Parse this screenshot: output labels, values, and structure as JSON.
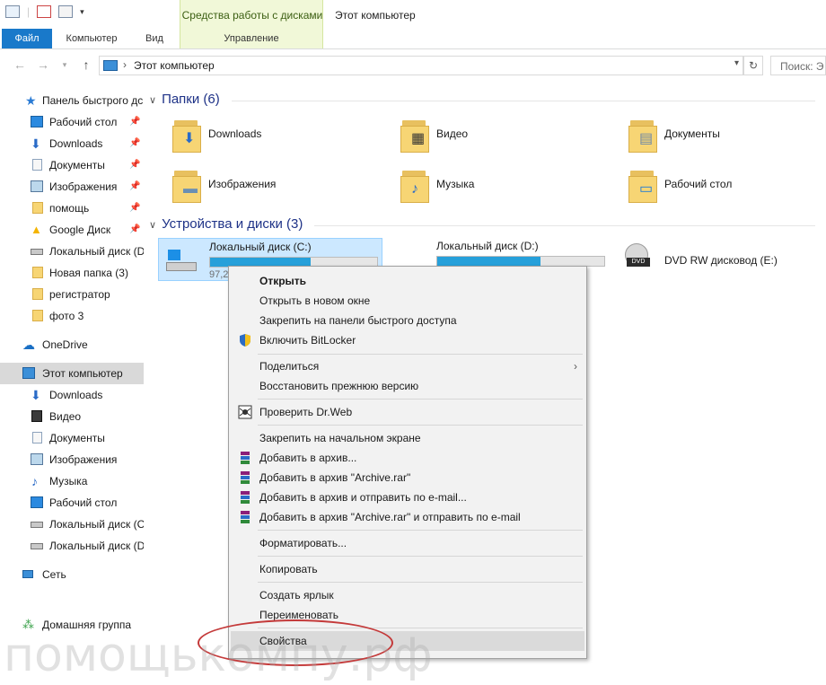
{
  "window": {
    "title": "Этот компьютер",
    "context_tab_group": "Средства работы с дисками"
  },
  "ribbon": {
    "tabs": [
      {
        "label": "Файл",
        "active": true
      },
      {
        "label": "Компьютер"
      },
      {
        "label": "Вид"
      },
      {
        "label": "Управление"
      }
    ]
  },
  "address": {
    "path": "Этот компьютер",
    "search_placeholder": "Поиск: Э"
  },
  "sidebar": {
    "items": [
      {
        "label": "Панель быстрого дс",
        "icon": "star-icon",
        "pinned": false
      },
      {
        "label": "Рабочий стол",
        "icon": "desktop-icon",
        "pinned": true
      },
      {
        "label": "Downloads",
        "icon": "download-arrow-icon",
        "pinned": true
      },
      {
        "label": "Документы",
        "icon": "document-icon",
        "pinned": true
      },
      {
        "label": "Изображения",
        "icon": "pictures-icon",
        "pinned": true
      },
      {
        "label": "помощь",
        "icon": "folder-icon",
        "pinned": true
      },
      {
        "label": "Google Диск",
        "icon": "google-drive-icon",
        "pinned": true
      },
      {
        "label": "Локальный диск (D",
        "icon": "drive-icon",
        "pinned": false
      },
      {
        "label": "Новая папка (3)",
        "icon": "folder-icon",
        "pinned": false
      },
      {
        "label": "регистратор",
        "icon": "folder-icon",
        "pinned": false
      },
      {
        "label": "фото 3",
        "icon": "folder-icon",
        "pinned": false
      },
      {
        "label": "OneDrive",
        "icon": "cloud-icon",
        "pinned": false
      },
      {
        "label": "Этот компьютер",
        "icon": "computer-icon",
        "pinned": false,
        "selected": true
      },
      {
        "label": "Downloads",
        "icon": "download-arrow-icon",
        "pinned": false
      },
      {
        "label": "Видео",
        "icon": "video-icon",
        "pinned": false
      },
      {
        "label": "Документы",
        "icon": "document-icon",
        "pinned": false
      },
      {
        "label": "Изображения",
        "icon": "pictures-icon",
        "pinned": false
      },
      {
        "label": "Музыка",
        "icon": "music-icon",
        "pinned": false
      },
      {
        "label": "Рабочий стол",
        "icon": "desktop-icon",
        "pinned": false
      },
      {
        "label": "Локальный диск (C",
        "icon": "windows-drive-icon",
        "pinned": false
      },
      {
        "label": "Локальный диск (D",
        "icon": "drive-icon",
        "pinned": false
      },
      {
        "label": "Сеть",
        "icon": "network-icon",
        "pinned": false
      },
      {
        "label": "Домашняя группа",
        "icon": "homegroup-icon",
        "pinned": false
      }
    ]
  },
  "main": {
    "folders_header": "Папки (6)",
    "folders": [
      {
        "label": "Downloads",
        "icon": "download-arrow-icon"
      },
      {
        "label": "Видео",
        "icon": "video-icon"
      },
      {
        "label": "Документы",
        "icon": "document-icon"
      },
      {
        "label": "Изображения",
        "icon": "pictures-icon"
      },
      {
        "label": "Музыка",
        "icon": "music-icon"
      },
      {
        "label": "Рабочий стол",
        "icon": "desktop-icon"
      }
    ],
    "devices_header": "Устройства и диски (3)",
    "drives": [
      {
        "label": "Локальный диск (C:)",
        "size_text": "97,2",
        "used_fraction": 0.6,
        "icon": "windows-drive-icon",
        "selected": true
      },
      {
        "label": "Локальный диск (D:)",
        "used_fraction": 0.62,
        "icon": "drive-icon"
      },
      {
        "label": "DVD RW дисковод (E:)",
        "icon": "dvd-drive-icon"
      }
    ]
  },
  "context_menu": {
    "items": [
      {
        "label": "Открыть",
        "bold": true
      },
      {
        "label": "Открыть в новом окне"
      },
      {
        "label": "Закрепить на панели быстрого доступа"
      },
      {
        "label": "Включить BitLocker",
        "icon": "shield-icon"
      },
      {
        "label": "Поделиться",
        "submenu": true
      },
      {
        "label": "Восстановить прежнюю версию"
      },
      {
        "label": "Проверить Dr.Web",
        "icon": "drweb-spider-icon"
      },
      {
        "label": "Закрепить на начальном экране"
      },
      {
        "label": "Добавить в архив...",
        "icon": "winrar-icon"
      },
      {
        "label": "Добавить в архив \"Archive.rar\"",
        "icon": "winrar-icon"
      },
      {
        "label": "Добавить в архив и отправить по e-mail...",
        "icon": "winrar-icon"
      },
      {
        "label": "Добавить в архив \"Archive.rar\" и отправить по e-mail",
        "icon": "winrar-icon"
      },
      {
        "label": "Форматировать..."
      },
      {
        "label": "Копировать"
      },
      {
        "label": "Создать ярлык"
      },
      {
        "label": "Переименовать"
      },
      {
        "label": "Свойства",
        "highlighted": true
      }
    ]
  },
  "watermark": "помощькомпу.рф",
  "colors": {
    "accent": "#1979ca",
    "selection": "#cce8ff",
    "annotation": "#c43a3a"
  }
}
